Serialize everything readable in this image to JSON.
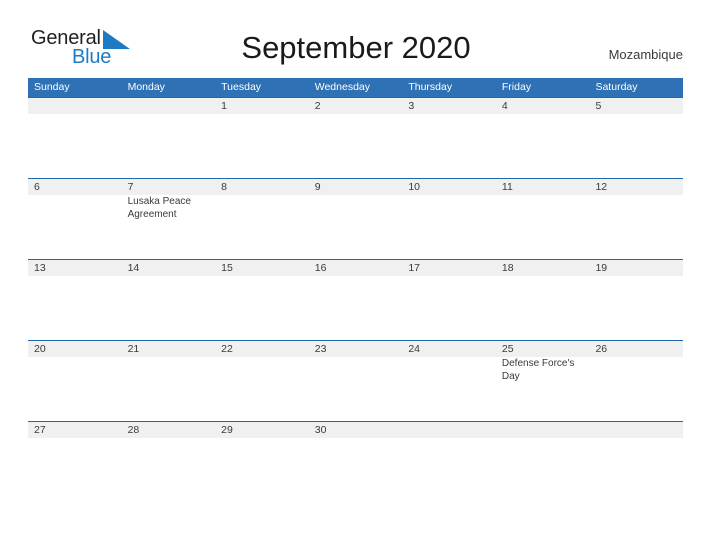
{
  "brand": {
    "name_part1": "General",
    "name_part2": "Blue",
    "mark_icon": "blue-triangle-flag-icon",
    "color_dark": "#231f20",
    "color_blue": "#1f7ac4"
  },
  "header": {
    "title": "September 2020",
    "country": "Mozambique"
  },
  "theme": {
    "header_blue": "#2e71b5",
    "rule_blue": "#2168ab",
    "date_band_gray": "#f0f0f0",
    "text": "#3a3a3a"
  },
  "calendar": {
    "weekdays": [
      "Sunday",
      "Monday",
      "Tuesday",
      "Wednesday",
      "Thursday",
      "Friday",
      "Saturday"
    ],
    "weeks": [
      [
        {
          "day": "",
          "event": ""
        },
        {
          "day": "",
          "event": ""
        },
        {
          "day": "1",
          "event": ""
        },
        {
          "day": "2",
          "event": ""
        },
        {
          "day": "3",
          "event": ""
        },
        {
          "day": "4",
          "event": ""
        },
        {
          "day": "5",
          "event": ""
        }
      ],
      [
        {
          "day": "6",
          "event": ""
        },
        {
          "day": "7",
          "event": "Lusaka Peace Agreement"
        },
        {
          "day": "8",
          "event": ""
        },
        {
          "day": "9",
          "event": ""
        },
        {
          "day": "10",
          "event": ""
        },
        {
          "day": "11",
          "event": ""
        },
        {
          "day": "12",
          "event": ""
        }
      ],
      [
        {
          "day": "13",
          "event": ""
        },
        {
          "day": "14",
          "event": ""
        },
        {
          "day": "15",
          "event": ""
        },
        {
          "day": "16",
          "event": ""
        },
        {
          "day": "17",
          "event": ""
        },
        {
          "day": "18",
          "event": ""
        },
        {
          "day": "19",
          "event": ""
        }
      ],
      [
        {
          "day": "20",
          "event": ""
        },
        {
          "day": "21",
          "event": ""
        },
        {
          "day": "22",
          "event": ""
        },
        {
          "day": "23",
          "event": ""
        },
        {
          "day": "24",
          "event": ""
        },
        {
          "day": "25",
          "event": "Defense Force's Day"
        },
        {
          "day": "26",
          "event": ""
        }
      ],
      [
        {
          "day": "27",
          "event": ""
        },
        {
          "day": "28",
          "event": ""
        },
        {
          "day": "29",
          "event": ""
        },
        {
          "day": "30",
          "event": ""
        },
        {
          "day": "",
          "event": ""
        },
        {
          "day": "",
          "event": ""
        },
        {
          "day": "",
          "event": ""
        }
      ]
    ]
  }
}
